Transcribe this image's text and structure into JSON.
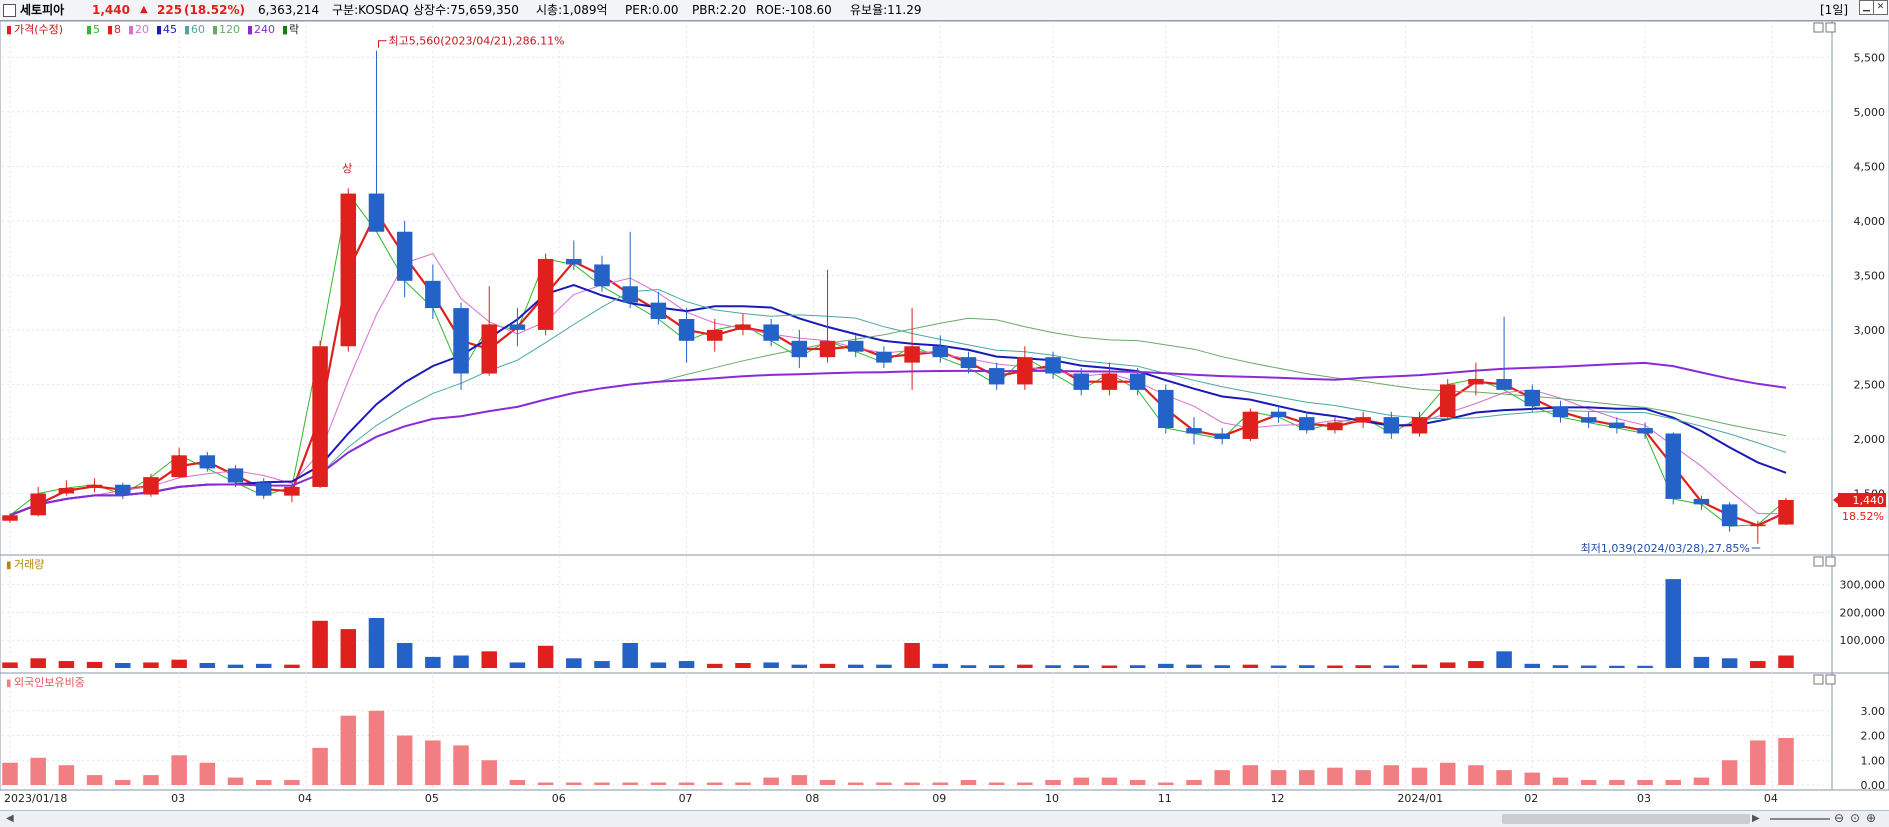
{
  "header": {
    "checkbox": "",
    "name": "세토피아",
    "price": "1,440",
    "change_arrow": "▲",
    "change": "225",
    "change_pct": "(18.52%)",
    "volume": "6,363,214",
    "market": "구분:KOSDAQ",
    "shares": "상장수:75,659,350",
    "market_cap": "시총:1,089억",
    "per": "PER:0.00",
    "pbr": "PBR:2.20",
    "roe": "ROE:-108.60",
    "float": "유보율:11.29",
    "period_button": "[1일]"
  },
  "legend": {
    "price_label": "가격(수정)",
    "ma": [
      {
        "label": "5",
        "color": "#2fb82f"
      },
      {
        "label": "8",
        "color": "#e0201c"
      },
      {
        "label": "20",
        "color": "#d86fd0"
      },
      {
        "label": "45",
        "color": "#1a1ab8"
      },
      {
        "label": "60",
        "color": "#49a8a2"
      },
      {
        "label": "120",
        "color": "#6aa86a"
      },
      {
        "label": "240",
        "color": "#8a2bd6"
      }
    ],
    "rak": "락"
  },
  "annotations": {
    "high": "최고5,560(2023/04/21),286.11%",
    "low": "최저1,039(2024/03/28),27.85%",
    "limit_up": "상"
  },
  "current_price_tag": {
    "price": "1,440",
    "pct": "18.52%"
  },
  "colors": {
    "up": "#e0201c",
    "down": "#2462c8",
    "foreign": "#f07e82",
    "grid": "#e2e4ec"
  },
  "chart_data": [
    {
      "type": "candlestick",
      "title": "가격(수정)",
      "y_ticks": [
        1500,
        2000,
        2500,
        3000,
        3500,
        4000,
        4500,
        5000,
        5500
      ],
      "ylim": [
        1000,
        5750
      ],
      "x_start": "2023/01/18",
      "x_ticks": [
        "2023/01/18",
        "03",
        "04",
        "05",
        "06",
        "07",
        "08",
        "09",
        "10",
        "11",
        "12",
        "2024/01",
        "02",
        "03",
        "04"
      ],
      "x_tick_weeks": [
        0,
        6,
        10.5,
        15,
        19.5,
        24,
        28.5,
        33,
        37,
        41,
        45,
        49.5,
        54,
        58,
        62.5
      ],
      "weekly_ohlc": [
        [
          1250,
          1320,
          1230,
          1300
        ],
        [
          1300,
          1560,
          1290,
          1500
        ],
        [
          1500,
          1620,
          1480,
          1550
        ],
        [
          1550,
          1640,
          1510,
          1580
        ],
        [
          1580,
          1600,
          1450,
          1490
        ],
        [
          1490,
          1680,
          1470,
          1650
        ],
        [
          1650,
          1920,
          1640,
          1850
        ],
        [
          1850,
          1880,
          1700,
          1730
        ],
        [
          1730,
          1760,
          1560,
          1600
        ],
        [
          1600,
          1640,
          1450,
          1480
        ],
        [
          1480,
          1520,
          1420,
          1560
        ],
        [
          1560,
          2900,
          1550,
          2850
        ],
        [
          2850,
          4300,
          2800,
          4250
        ],
        [
          4250,
          5560,
          4100,
          3900
        ],
        [
          3900,
          4000,
          3300,
          3450
        ],
        [
          3450,
          3600,
          3100,
          3200
        ],
        [
          3200,
          3250,
          2450,
          2600
        ],
        [
          2600,
          3400,
          2580,
          3050
        ],
        [
          3050,
          3200,
          2850,
          3000
        ],
        [
          3000,
          3700,
          2950,
          3650
        ],
        [
          3650,
          3820,
          3550,
          3600
        ],
        [
          3600,
          3680,
          3350,
          3400
        ],
        [
          3400,
          3900,
          3200,
          3250
        ],
        [
          3250,
          3350,
          3050,
          3100
        ],
        [
          3100,
          3200,
          2700,
          2900
        ],
        [
          2900,
          3100,
          2800,
          3000
        ],
        [
          3000,
          3150,
          2950,
          3050
        ],
        [
          3050,
          3100,
          2850,
          2900
        ],
        [
          2900,
          3000,
          2650,
          2750
        ],
        [
          2750,
          3550,
          2700,
          2900
        ],
        [
          2900,
          2950,
          2750,
          2800
        ],
        [
          2800,
          2850,
          2650,
          2700
        ],
        [
          2700,
          3200,
          2450,
          2850
        ],
        [
          2850,
          2950,
          2700,
          2750
        ],
        [
          2750,
          2800,
          2600,
          2650
        ],
        [
          2650,
          2700,
          2450,
          2500
        ],
        [
          2500,
          2850,
          2450,
          2750
        ],
        [
          2750,
          2800,
          2550,
          2600
        ],
        [
          2600,
          2650,
          2400,
          2450
        ],
        [
          2450,
          2700,
          2400,
          2600
        ],
        [
          2600,
          2650,
          2400,
          2450
        ],
        [
          2450,
          2500,
          2050,
          2100
        ],
        [
          2100,
          2200,
          1950,
          2050
        ],
        [
          2050,
          2100,
          1950,
          2000
        ],
        [
          2000,
          2280,
          1980,
          2250
        ],
        [
          2250,
          2300,
          2150,
          2200
        ],
        [
          2200,
          2250,
          2050,
          2080
        ],
        [
          2080,
          2200,
          2050,
          2150
        ],
        [
          2150,
          2250,
          2100,
          2200
        ],
        [
          2200,
          2250,
          2000,
          2050
        ],
        [
          2050,
          2250,
          2020,
          2200
        ],
        [
          2200,
          2550,
          2180,
          2500
        ],
        [
          2500,
          2700,
          2400,
          2550
        ],
        [
          2550,
          3120,
          2500,
          2450
        ],
        [
          2450,
          2500,
          2250,
          2300
        ],
        [
          2300,
          2350,
          2150,
          2200
        ],
        [
          2200,
          2250,
          2100,
          2150
        ],
        [
          2150,
          2200,
          2050,
          2100
        ],
        [
          2100,
          2150,
          2000,
          2050
        ],
        [
          2050,
          2060,
          1400,
          1450
        ],
        [
          1450,
          1480,
          1350,
          1400
        ],
        [
          1400,
          1420,
          1150,
          1200
        ],
        [
          1200,
          1250,
          1039,
          1215
        ],
        [
          1215,
          1460,
          1210,
          1440
        ]
      ],
      "volume": {
        "title": "거래량",
        "y_ticks": [
          100000,
          200000,
          300000
        ],
        "ylim": [
          0,
          360000
        ],
        "weekly": [
          20000,
          35000,
          25000,
          22000,
          18000,
          20000,
          30000,
          18000,
          12000,
          15000,
          12000,
          170000,
          140000,
          180000,
          90000,
          40000,
          45000,
          60000,
          20000,
          80000,
          35000,
          25000,
          90000,
          20000,
          25000,
          15000,
          18000,
          20000,
          12000,
          15000,
          12000,
          12000,
          90000,
          15000,
          10000,
          10000,
          12000,
          10000,
          10000,
          9000,
          10000,
          15000,
          12000,
          10000,
          12000,
          9000,
          10000,
          9000,
          10000,
          9000,
          12000,
          20000,
          25000,
          60000,
          15000,
          10000,
          9000,
          8000,
          8000,
          320000,
          40000,
          35000,
          25000,
          45000
        ]
      },
      "foreign": {
        "title": "외국인보유비중",
        "y_ticks": [
          0,
          1,
          2,
          3
        ],
        "ylim": [
          0,
          4
        ],
        "weekly": [
          0.9,
          1.1,
          0.8,
          0.4,
          0.2,
          0.4,
          1.2,
          0.9,
          0.3,
          0.2,
          0.2,
          1.5,
          2.8,
          3.0,
          2.0,
          1.8,
          1.6,
          1.0,
          0.2,
          0.1,
          0.1,
          0.1,
          0.1,
          0.1,
          0.1,
          0.1,
          0.1,
          0.3,
          0.4,
          0.2,
          0.1,
          0.1,
          0.1,
          0.1,
          0.2,
          0.1,
          0.1,
          0.2,
          0.3,
          0.3,
          0.2,
          0.1,
          0.2,
          0.6,
          0.8,
          0.6,
          0.6,
          0.7,
          0.6,
          0.8,
          0.7,
          0.9,
          0.8,
          0.6,
          0.5,
          0.3,
          0.2,
          0.2,
          0.2,
          0.2,
          0.3,
          1.0,
          1.8,
          1.9
        ]
      }
    }
  ]
}
